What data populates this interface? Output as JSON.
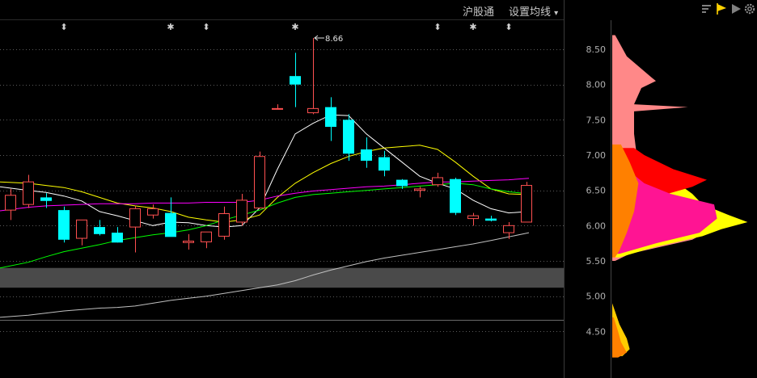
{
  "toolbar": {
    "hgt_label": "沪股通",
    "ma_settings_label": "设置均线",
    "dropdown_glyph": "▾"
  },
  "side_tools": [
    {
      "name": "list-settings-icon",
      "color": "#a0a0a0"
    },
    {
      "name": "flag-icon",
      "color": "#ffd200"
    },
    {
      "name": "play-icon",
      "color": "#808080"
    },
    {
      "name": "gear-icon",
      "color": "#909090"
    }
  ],
  "colors": {
    "up": "#ff5050",
    "down": "#00ffff",
    "ma5": "#ffffff",
    "ma10": "#ffff00",
    "ma20": "#ff00ff",
    "ma30": "#00ff00",
    "ma120": "#c0c0c0",
    "grid": "#5a5a5a",
    "panel_border": "#3a3a3a",
    "price_band": "#4a4a4a"
  },
  "chart_data": {
    "type": "candlestick",
    "price_range": [
      4.1,
      8.85
    ],
    "yaxis_ticks": [
      "8.50",
      "8.00",
      "7.50",
      "7.00",
      "6.50",
      "6.00",
      "5.50",
      "5.00",
      "4.50"
    ],
    "annotation": {
      "label": "8.66",
      "value": 8.66,
      "candle_index": 17
    },
    "markers": [
      {
        "candle_index": 3,
        "symbol": "⬍"
      },
      {
        "candle_index": 9,
        "symbol": "✱"
      },
      {
        "candle_index": 11,
        "symbol": "⬍"
      },
      {
        "candle_index": 16,
        "symbol": "✱"
      },
      {
        "candle_index": 24,
        "symbol": "⬍"
      },
      {
        "candle_index": 26,
        "symbol": "✱"
      },
      {
        "candle_index": 28,
        "symbol": "⬍"
      }
    ],
    "price_band": [
      5.12,
      5.4
    ],
    "candles": [
      {
        "o": 6.22,
        "h": 6.52,
        "l": 6.08,
        "c": 6.43
      },
      {
        "o": 6.3,
        "h": 6.72,
        "l": 6.25,
        "c": 6.62
      },
      {
        "o": 6.4,
        "h": 6.46,
        "l": 6.25,
        "c": 6.35
      },
      {
        "o": 6.22,
        "h": 6.27,
        "l": 5.76,
        "c": 5.8
      },
      {
        "o": 5.82,
        "h": 6.08,
        "l": 5.72,
        "c": 6.08
      },
      {
        "o": 5.98,
        "h": 6.08,
        "l": 5.86,
        "c": 5.88
      },
      {
        "o": 5.9,
        "h": 5.98,
        "l": 5.76,
        "c": 5.76
      },
      {
        "o": 5.98,
        "h": 6.28,
        "l": 5.62,
        "c": 6.24
      },
      {
        "o": 6.15,
        "h": 6.3,
        "l": 6.1,
        "c": 6.24
      },
      {
        "o": 6.18,
        "h": 6.4,
        "l": 5.88,
        "c": 5.84
      },
      {
        "o": 5.76,
        "h": 5.88,
        "l": 5.66,
        "c": 5.78
      },
      {
        "o": 5.77,
        "h": 5.88,
        "l": 5.68,
        "c": 5.91
      },
      {
        "o": 5.85,
        "h": 6.27,
        "l": 5.8,
        "c": 6.17
      },
      {
        "o": 6.05,
        "h": 6.45,
        "l": 6.0,
        "c": 6.36
      },
      {
        "o": 6.25,
        "h": 7.05,
        "l": 6.25,
        "c": 6.98
      },
      {
        "o": 7.65,
        "h": 7.72,
        "l": 7.65,
        "c": 7.66
      },
      {
        "o": 8.12,
        "h": 8.45,
        "l": 7.68,
        "c": 8.0
      },
      {
        "o": 7.6,
        "h": 8.66,
        "l": 7.58,
        "c": 7.66
      },
      {
        "o": 7.68,
        "h": 7.82,
        "l": 7.2,
        "c": 7.4
      },
      {
        "o": 7.5,
        "h": 7.58,
        "l": 6.92,
        "c": 7.02
      },
      {
        "o": 7.08,
        "h": 7.25,
        "l": 6.82,
        "c": 6.92
      },
      {
        "o": 6.97,
        "h": 7.06,
        "l": 6.7,
        "c": 6.78
      },
      {
        "o": 6.65,
        "h": 6.66,
        "l": 6.52,
        "c": 6.56
      },
      {
        "o": 6.5,
        "h": 6.55,
        "l": 6.4,
        "c": 6.52
      },
      {
        "o": 6.58,
        "h": 6.75,
        "l": 6.55,
        "c": 6.68
      },
      {
        "o": 6.66,
        "h": 6.68,
        "l": 6.15,
        "c": 6.18
      },
      {
        "o": 6.1,
        "h": 6.18,
        "l": 6.0,
        "c": 6.14
      },
      {
        "o": 6.1,
        "h": 6.14,
        "l": 6.06,
        "c": 6.07
      },
      {
        "o": 5.9,
        "h": 6.05,
        "l": 5.81,
        "c": 6.0
      },
      {
        "o": 6.05,
        "h": 6.62,
        "l": 6.05,
        "c": 6.57
      }
    ],
    "moving_averages": [
      {
        "name": "MA5",
        "colorKey": "ma5",
        "values": [
          6.55,
          6.5,
          6.47,
          6.42,
          6.35,
          6.2,
          6.14,
          6.07,
          6.0,
          6.05,
          6.04,
          6.0,
          5.98,
          6.0,
          6.25,
          6.8,
          7.3,
          7.45,
          7.57,
          7.56,
          7.3,
          7.1,
          6.9,
          6.7,
          6.6,
          6.52,
          6.36,
          6.24,
          6.18,
          6.2
        ]
      },
      {
        "name": "MA10",
        "colorKey": "ma10",
        "values": [
          6.62,
          6.6,
          6.57,
          6.54,
          6.48,
          6.4,
          6.32,
          6.28,
          6.25,
          6.2,
          6.12,
          6.08,
          6.05,
          6.08,
          6.15,
          6.4,
          6.6,
          6.75,
          6.88,
          6.98,
          7.05,
          7.1,
          7.12,
          7.14,
          7.08,
          6.9,
          6.7,
          6.52,
          6.45,
          6.44
        ]
      },
      {
        "name": "MA20",
        "colorKey": "ma20",
        "values": [
          6.21,
          6.26,
          6.28,
          6.29,
          6.3,
          6.31,
          6.31,
          6.31,
          6.32,
          6.32,
          6.32,
          6.33,
          6.33,
          6.33,
          6.36,
          6.42,
          6.46,
          6.49,
          6.51,
          6.53,
          6.55,
          6.56,
          6.58,
          6.6,
          6.62,
          6.62,
          6.63,
          6.64,
          6.65,
          6.67
        ]
      },
      {
        "name": "MA30",
        "colorKey": "ma30",
        "values": [
          5.4,
          5.48,
          5.56,
          5.63,
          5.68,
          5.73,
          5.79,
          5.83,
          5.87,
          5.9,
          5.94,
          6.0,
          6.08,
          6.15,
          6.22,
          6.32,
          6.4,
          6.44,
          6.46,
          6.48,
          6.5,
          6.52,
          6.54,
          6.56,
          6.58,
          6.6,
          6.58,
          6.52,
          6.48,
          6.45
        ]
      },
      {
        "name": "MA120",
        "colorKey": "ma120",
        "values": [
          4.7,
          4.73,
          4.76,
          4.79,
          4.81,
          4.83,
          4.84,
          4.86,
          4.9,
          4.94,
          4.97,
          5.0,
          5.04,
          5.08,
          5.12,
          5.16,
          5.22,
          5.3,
          5.37,
          5.43,
          5.49,
          5.54,
          5.58,
          5.62,
          5.66,
          5.7,
          5.74,
          5.79,
          5.84,
          5.9
        ]
      }
    ],
    "chip_distribution": {
      "layers": [
        {
          "color": "#ff8888",
          "points": [
            [
              8.7,
              0.02
            ],
            [
              8.4,
              0.1
            ],
            [
              8.1,
              0.27
            ],
            [
              8.05,
              0.3
            ],
            [
              7.95,
              0.2
            ],
            [
              7.72,
              0.15
            ],
            [
              7.68,
              0.52
            ],
            [
              7.62,
              0.15
            ],
            [
              7.3,
              0.15
            ],
            [
              6.8,
              0.18
            ],
            [
              6.4,
              0.38
            ],
            [
              6.2,
              0.7
            ],
            [
              6.05,
              0.78
            ],
            [
              5.8,
              0.55
            ],
            [
              5.6,
              0.12
            ],
            [
              5.5,
              0.02
            ]
          ]
        },
        {
          "color": "#ffff00",
          "points": [
            [
              7.1,
              0.08
            ],
            [
              6.6,
              0.45
            ],
            [
              6.45,
              0.55
            ],
            [
              6.3,
              0.62
            ],
            [
              6.15,
              0.8
            ],
            [
              6.05,
              0.93
            ],
            [
              5.95,
              0.75
            ],
            [
              5.85,
              0.62
            ],
            [
              5.7,
              0.3
            ],
            [
              5.55,
              0.05
            ]
          ]
        },
        {
          "color": "#ff0000",
          "points": [
            [
              7.1,
              0.15
            ],
            [
              7.0,
              0.22
            ],
            [
              6.8,
              0.42
            ],
            [
              6.65,
              0.65
            ],
            [
              6.55,
              0.55
            ],
            [
              6.45,
              0.38
            ],
            [
              6.3,
              0.25
            ],
            [
              6.1,
              0.12
            ],
            [
              5.9,
              0.05
            ]
          ]
        },
        {
          "color": "#ff1493",
          "points": [
            [
              6.8,
              0.1
            ],
            [
              6.6,
              0.22
            ],
            [
              6.45,
              0.4
            ],
            [
              6.3,
              0.7
            ],
            [
              6.1,
              0.72
            ],
            [
              5.9,
              0.6
            ],
            [
              5.75,
              0.3
            ],
            [
              5.6,
              0.05
            ]
          ]
        },
        {
          "color": "#ff8000",
          "points": [
            [
              7.15,
              0.06
            ],
            [
              6.9,
              0.12
            ],
            [
              6.6,
              0.18
            ],
            [
              6.2,
              0.15
            ],
            [
              5.9,
              0.1
            ],
            [
              5.65,
              0.05
            ],
            [
              5.55,
              0.02
            ]
          ]
        },
        {
          "color": "#ffcc00",
          "points": [
            [
              4.9,
              0.0
            ],
            [
              4.6,
              0.05
            ],
            [
              4.4,
              0.1
            ],
            [
              4.25,
              0.12
            ],
            [
              4.15,
              0.07
            ]
          ]
        },
        {
          "color": "#ff8000",
          "points": [
            [
              4.7,
              0.01
            ],
            [
              4.5,
              0.04
            ],
            [
              4.35,
              0.06
            ],
            [
              4.2,
              0.1
            ],
            [
              4.13,
              0.04
            ]
          ]
        }
      ]
    }
  }
}
